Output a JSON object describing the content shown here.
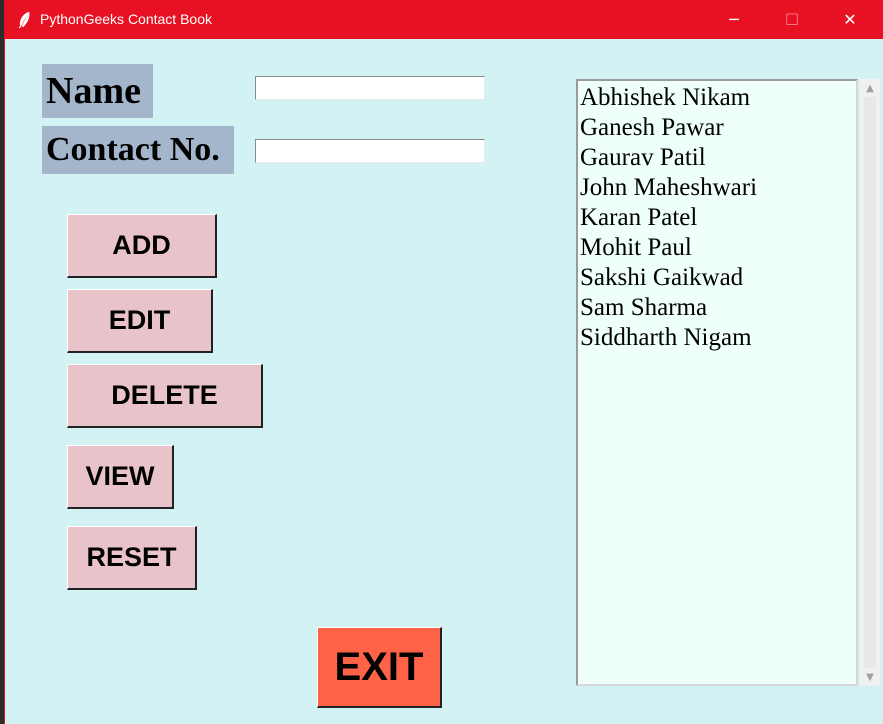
{
  "window": {
    "title": "PythonGeeks Contact Book",
    "icon": "feather-icon",
    "controls": {
      "minimize": "─",
      "maximize": "☐",
      "close": "✕"
    },
    "accent": "#e81123",
    "background": "#d3f2f3"
  },
  "form": {
    "name_label": "Name",
    "contact_label": "Contact No.",
    "name_value": "",
    "contact_value": ""
  },
  "buttons": {
    "add": "ADD",
    "edit": "EDIT",
    "delete": "DELETE",
    "view": "VIEW",
    "reset": "RESET",
    "exit": "EXIT"
  },
  "contacts": [
    "Abhishek Nikam",
    "Ganesh Pawar",
    "Gaurav Patil",
    "John Maheshwari",
    "Karan Patel",
    "Mohit Paul",
    "Sakshi Gaikwad",
    "Sam Sharma",
    "Siddharth Nigam"
  ],
  "scrollbar": {
    "up": "▲",
    "down": "▼"
  }
}
